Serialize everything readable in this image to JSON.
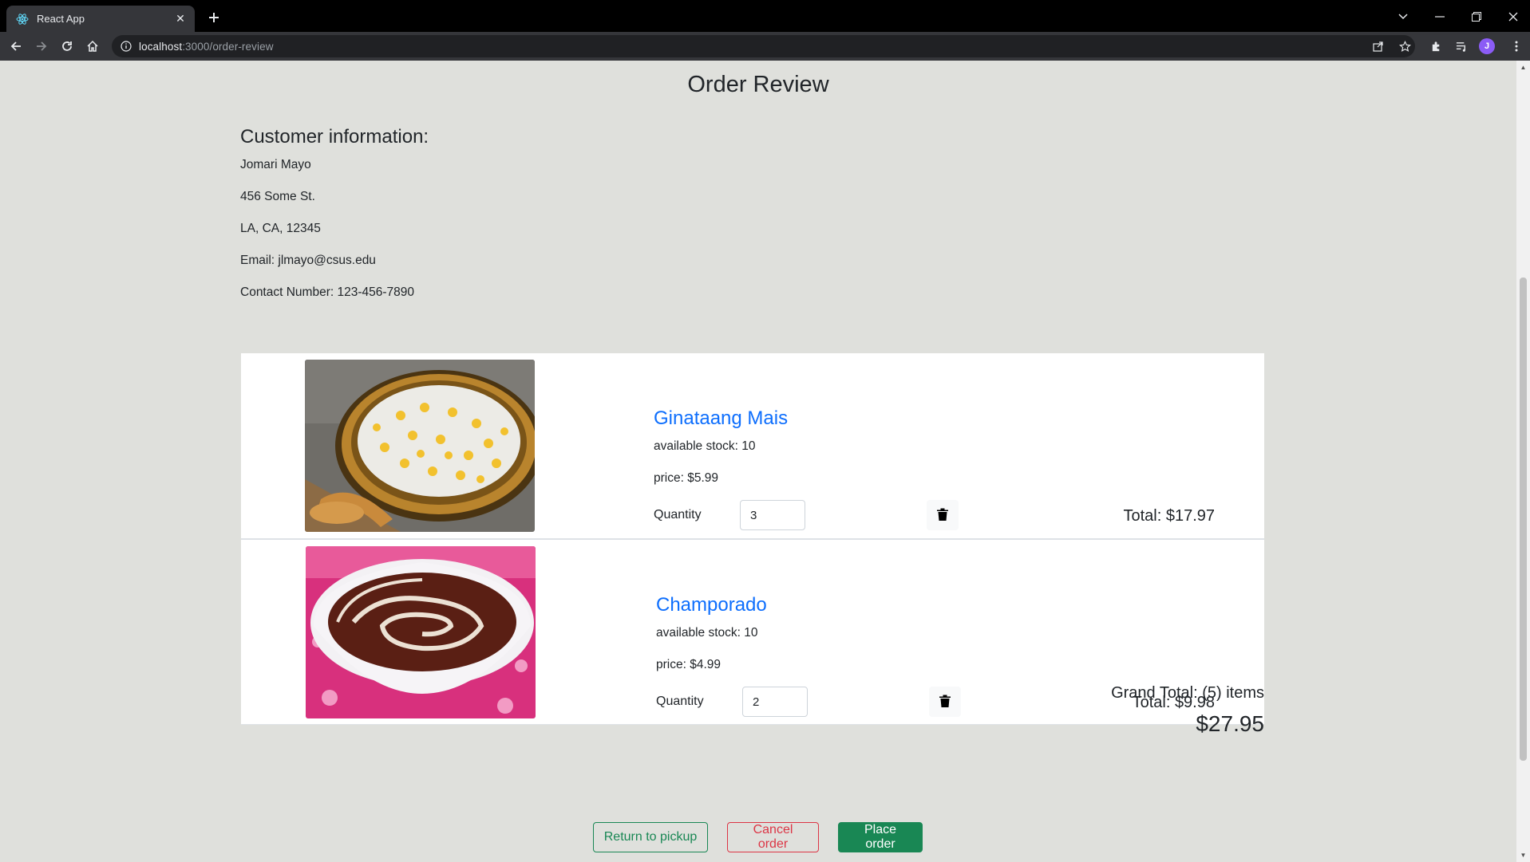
{
  "browser": {
    "tab_title": "React App",
    "url_host": "localhost",
    "url_rest": ":3000/order-review",
    "profile_initial": "J"
  },
  "page": {
    "title": "Order Review"
  },
  "customer": {
    "heading": "Customer information:",
    "name": "Jomari Mayo",
    "street": "456 Some St.",
    "city_line": "LA, CA, 12345",
    "email": "Email: jlmayo@csus.edu",
    "contact": "Contact Number: 123-456-7890"
  },
  "cart": {
    "items": [
      {
        "name": "Ginataang Mais",
        "stock": "available stock: 10",
        "price": "price: $5.99",
        "quantity_label": "Quantity",
        "quantity": "3",
        "total": "Total: $17.97",
        "image_icon": "corn-porridge-photo"
      },
      {
        "name": "Champorado",
        "stock": "available stock: 10",
        "price": "price: $4.99",
        "quantity_label": "Quantity",
        "quantity": "2",
        "total": "Total: $9.98",
        "image_icon": "chocolate-porridge-photo"
      }
    ]
  },
  "summary": {
    "grand_total_label": "Grand Total: (5) items",
    "grand_total_amount": "$27.95"
  },
  "actions": {
    "return_label": "Return to pickup",
    "cancel_label": "Cancel order",
    "place_label": "Place order"
  },
  "colors": {
    "page_bg": "#dfe0dc",
    "link": "#0d6efd",
    "success": "#198754",
    "danger": "#dc3545"
  }
}
